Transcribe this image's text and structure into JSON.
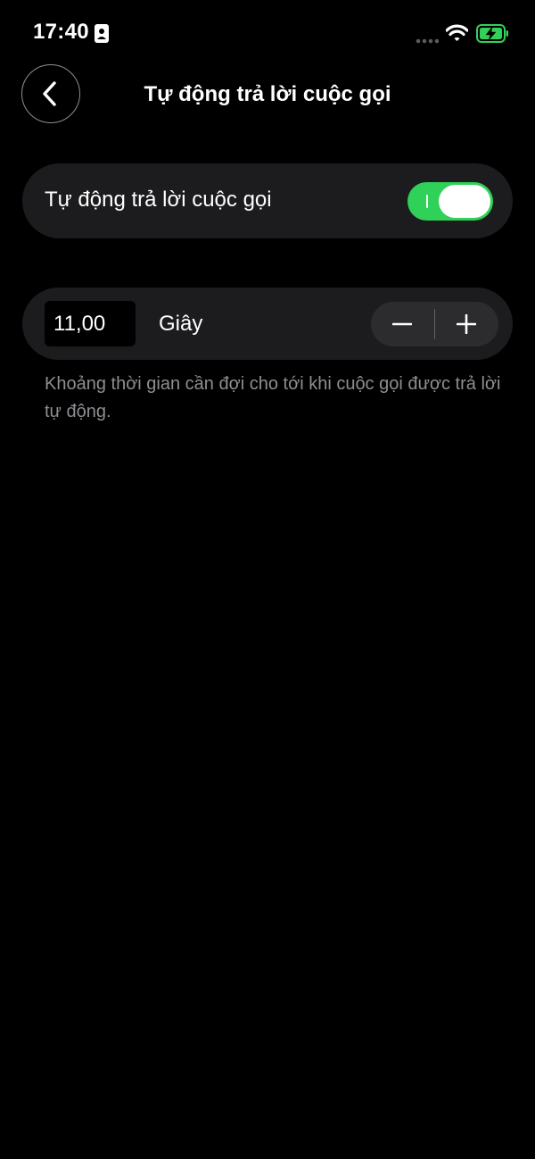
{
  "status_bar": {
    "time": "17:40",
    "icons": [
      "person-badge-icon",
      "signal-dots-icon",
      "wifi-icon",
      "battery-charging-icon"
    ],
    "battery_color": "#30d158"
  },
  "nav": {
    "back_icon": "chevron-left-icon",
    "title": "Tự động trả lời cuộc gọi"
  },
  "auto_answer": {
    "label": "Tự động trả lời cuộc gọi",
    "enabled": true,
    "toggle_color": "#30d158"
  },
  "delay": {
    "value": "11,00",
    "unit": "Giây",
    "decrement_icon": "minus-icon",
    "increment_icon": "plus-icon",
    "help_text": "Khoảng thời gian cần đợi cho tới khi cuộc gọi được trả lời tự động."
  }
}
